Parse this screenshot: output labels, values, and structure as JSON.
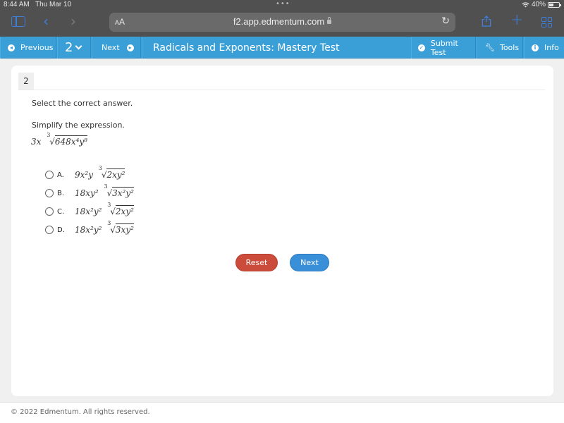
{
  "status_bar": {
    "time": "8:44 AM",
    "date": "Thu Mar 10",
    "battery": "40%"
  },
  "browser": {
    "text_size_label": "AA",
    "url": "f2.app.edmentum.com",
    "icons": [
      "sidebar-icon",
      "back-icon",
      "forward-icon",
      "lock-icon",
      "reload-icon",
      "share-icon",
      "new-tab-icon",
      "tabs-grid-icon"
    ]
  },
  "toolbar": {
    "previous_label": "Previous",
    "question_number": "2",
    "next_label": "Next",
    "test_title": "Radicals and Exponents: Mastery Test",
    "submit_label": "Submit Test",
    "tools_label": "Tools",
    "info_label": "Info"
  },
  "question": {
    "number": "2",
    "instruction": "Select the correct answer.",
    "prompt": "Simplify the expression.",
    "expression": {
      "coefficient": "3x",
      "root_index": "3",
      "radicand": "648x⁴y⁸"
    },
    "options": [
      {
        "letter": "A.",
        "coefficient": "9x²y",
        "root_index": "3",
        "radicand": "2xy²"
      },
      {
        "letter": "B.",
        "coefficient": "18xy²",
        "root_index": "3",
        "radicand": "3x²y²"
      },
      {
        "letter": "C.",
        "coefficient": "18x²y²",
        "root_index": "3",
        "radicand": "2xy²"
      },
      {
        "letter": "D.",
        "coefficient": "18x²y²",
        "root_index": "3",
        "radicand": "3xy²"
      }
    ]
  },
  "actions": {
    "reset_label": "Reset",
    "next_label": "Next"
  },
  "footer": {
    "copyright": "© 2022 Edmentum. All rights reserved."
  },
  "colors": {
    "toolbar_blue": "#3a9fd6",
    "reset_red": "#cc4c3b",
    "next_blue": "#3a8fd9",
    "safari_gray": "#505050",
    "ios_blue": "#3d7fd9"
  }
}
